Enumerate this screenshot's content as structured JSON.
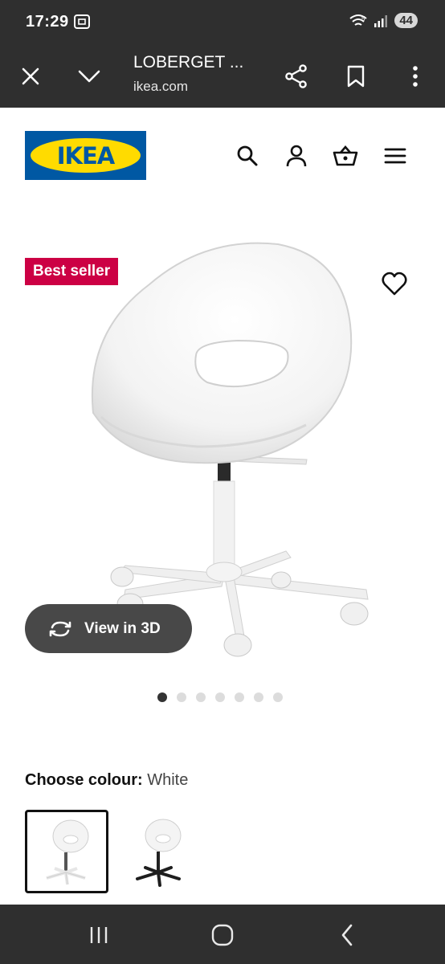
{
  "status": {
    "time": "17:29",
    "battery": "44",
    "network": "5"
  },
  "browser": {
    "title": "LOBERGET ...",
    "url": "ikea.com"
  },
  "header": {
    "logo_text": "IKEA",
    "icons": [
      "search-icon",
      "account-icon",
      "basket-icon",
      "menu-icon"
    ]
  },
  "product": {
    "badge": "Best seller",
    "view3d_label": "View in 3D",
    "carousel": {
      "count": 7,
      "active": 1
    },
    "colour_label": "Choose colour:",
    "colour_value": "White",
    "swatches": [
      {
        "name": "White",
        "selected": true,
        "color": "#f2f2f2",
        "base": "#f0f0f0"
      },
      {
        "name": "Black base",
        "selected": false,
        "color": "#f2f2f2",
        "base": "#1e1e1e"
      }
    ]
  },
  "colors": {
    "system_bar": "#2f2f2f",
    "ikea_blue": "#0058a3",
    "ikea_yellow": "#ffdb00",
    "badge_red": "#cc0044",
    "view3d_bg": "#484848"
  }
}
